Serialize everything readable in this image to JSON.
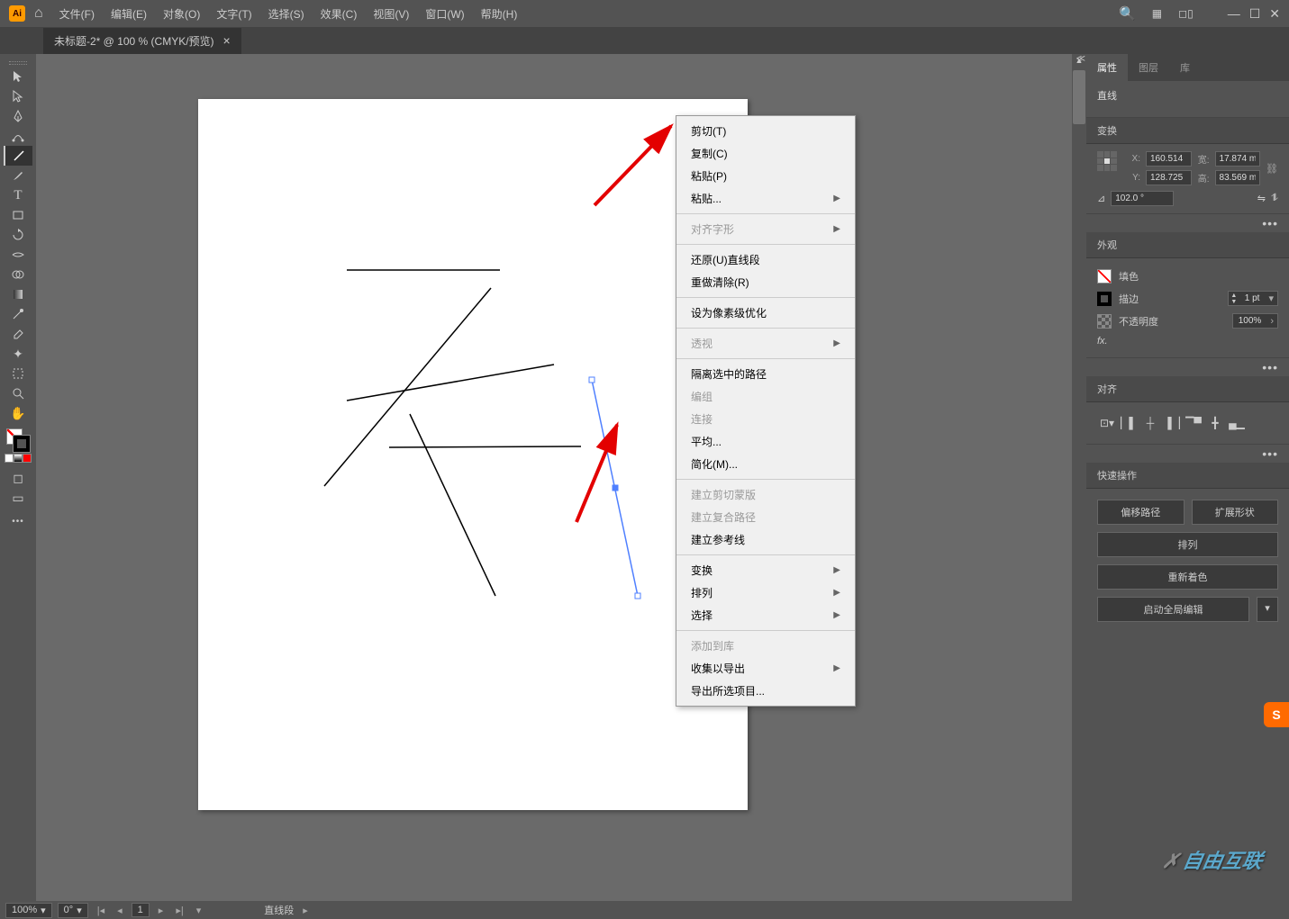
{
  "app": {
    "logo": "Ai"
  },
  "menu": {
    "file": "文件(F)",
    "edit": "编辑(E)",
    "object": "对象(O)",
    "type": "文字(T)",
    "select": "选择(S)",
    "effect": "效果(C)",
    "view": "视图(V)",
    "window": "窗口(W)",
    "help": "帮助(H)"
  },
  "tab": {
    "title": "未标题-2* @ 100 % (CMYK/预览)"
  },
  "context": {
    "cut": "剪切(T)",
    "copy": "复制(C)",
    "paste": "粘贴(P)",
    "paste_more": "粘贴...",
    "align_glyphs": "对齐字形",
    "undo": "还原(U)直线段",
    "redo": "重做清除(R)",
    "pixel_perfect": "设为像素级优化",
    "perspective": "透视",
    "isolate": "隔离选中的路径",
    "group": "编组",
    "join": "连接",
    "average": "平均...",
    "simplify": "简化(M)...",
    "make_clip": "建立剪切蒙版",
    "make_compound": "建立复合路径",
    "make_guides": "建立参考线",
    "transform": "变换",
    "arrange": "排列",
    "select": "选择",
    "add_library": "添加到库",
    "collect_export": "收集以导出",
    "export_selection": "导出所选项目..."
  },
  "panel": {
    "tabs": {
      "properties": "属性",
      "layers": "图层",
      "libraries": "库"
    },
    "object_type": "直线",
    "transform": {
      "header": "变换",
      "x": "160.514",
      "y": "128.725",
      "w": "17.874 m",
      "h": "83.569 m",
      "angle": "102.0 °",
      "x_lbl": "X:",
      "y_lbl": "Y:",
      "w_lbl": "宽:",
      "h_lbl": "高:"
    },
    "appearance": {
      "header": "外观",
      "fill": "填色",
      "stroke": "描边",
      "stroke_val": "1 pt",
      "opacity": "不透明度",
      "opacity_val": "100%",
      "fx": "fx."
    },
    "align": {
      "header": "对齐"
    },
    "quick": {
      "header": "快速操作",
      "offset": "偏移路径",
      "expand": "扩展形状",
      "arrange": "排列",
      "recolor": "重新着色",
      "global_edit": "启动全局编辑"
    }
  },
  "status": {
    "zoom": "100%",
    "rotation": "0°",
    "page": "1",
    "selection": "直线段"
  },
  "watermark": "自由互联"
}
